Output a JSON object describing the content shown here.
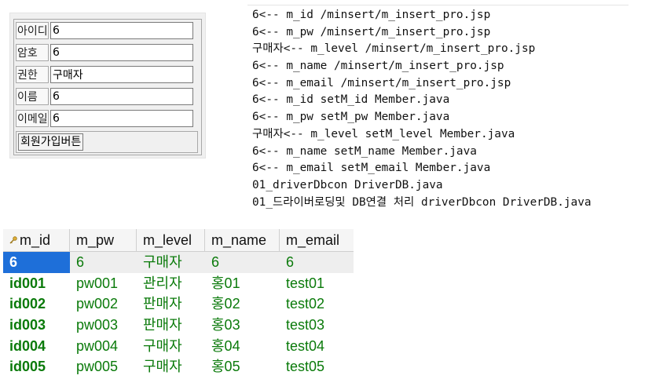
{
  "form": {
    "rows": [
      {
        "label": "아이디",
        "value": "6"
      },
      {
        "label": "암호",
        "value": "6"
      },
      {
        "label": "권한",
        "value": "구매자"
      },
      {
        "label": "이름",
        "value": "6"
      },
      {
        "label": "이메일",
        "value": "6"
      }
    ],
    "submit_label": "회원가입버튼"
  },
  "console": {
    "lines": [
      "6<-- m_id /minsert/m_insert_pro.jsp",
      "6<-- m_pw /minsert/m_insert_pro.jsp",
      "구매자<-- m_level /minsert/m_insert_pro.jsp",
      "6<-- m_name /minsert/m_insert_pro.jsp",
      "6<-- m_email /minsert/m_insert_pro.jsp",
      "6<-- m_id setM_id Member.java",
      "6<-- m_pw setM_pw Member.java",
      "구매자<-- m_level setM_level Member.java",
      "6<-- m_name setM_name Member.java",
      "6<-- m_email setM_email Member.java",
      "01_driverDbcon DriverDB.java",
      "01_드라이버로딩및 DB연결 처리 driverDbcon DriverDB.java"
    ]
  },
  "grid": {
    "columns": [
      "m_id",
      "m_pw",
      "m_level",
      "m_name",
      "m_email"
    ],
    "key_column_icon": "key-icon",
    "selected_row": 0,
    "rows": [
      [
        "6",
        "6",
        "구매자",
        "6",
        "6"
      ],
      [
        "id001",
        "pw001",
        "관리자",
        "홍01",
        "test01"
      ],
      [
        "id002",
        "pw002",
        "판매자",
        "홍02",
        "test02"
      ],
      [
        "id003",
        "pw003",
        "판매자",
        "홍03",
        "test03"
      ],
      [
        "id004",
        "pw004",
        "구매자",
        "홍04",
        "test04"
      ],
      [
        "id005",
        "pw005",
        "구매자",
        "홍05",
        "test05"
      ]
    ],
    "colors": {
      "value_text": "#0a7a0a",
      "selection": "#1e6fd9"
    }
  }
}
